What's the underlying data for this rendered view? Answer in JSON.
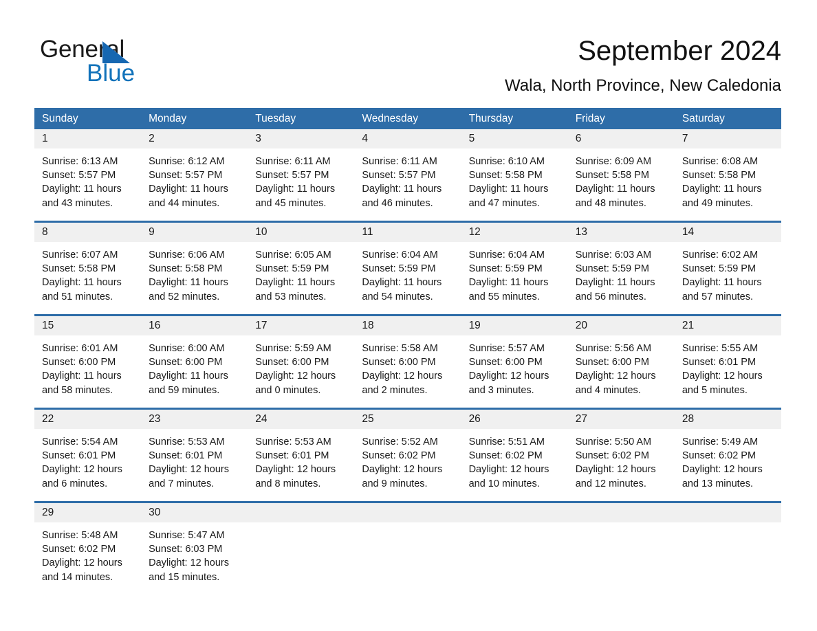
{
  "brand": {
    "name_part1": "General",
    "name_part2": "Blue",
    "accent_color": "#1172ba",
    "triangle_color": "#1667b1"
  },
  "header": {
    "title": "September 2024",
    "subtitle": "Wala, North Province, New Caledonia"
  },
  "theme": {
    "header_blue": "#2E6DA8",
    "day_band_gray": "#f0f0f0",
    "text_color": "#1a1a1a"
  },
  "weekdays": [
    "Sunday",
    "Monday",
    "Tuesday",
    "Wednesday",
    "Thursday",
    "Friday",
    "Saturday"
  ],
  "weeks": [
    [
      {
        "day": "1",
        "sunrise": "Sunrise: 6:13 AM",
        "sunset": "Sunset: 5:57 PM",
        "daylight1": "Daylight: 11 hours",
        "daylight2": "and 43 minutes."
      },
      {
        "day": "2",
        "sunrise": "Sunrise: 6:12 AM",
        "sunset": "Sunset: 5:57 PM",
        "daylight1": "Daylight: 11 hours",
        "daylight2": "and 44 minutes."
      },
      {
        "day": "3",
        "sunrise": "Sunrise: 6:11 AM",
        "sunset": "Sunset: 5:57 PM",
        "daylight1": "Daylight: 11 hours",
        "daylight2": "and 45 minutes."
      },
      {
        "day": "4",
        "sunrise": "Sunrise: 6:11 AM",
        "sunset": "Sunset: 5:57 PM",
        "daylight1": "Daylight: 11 hours",
        "daylight2": "and 46 minutes."
      },
      {
        "day": "5",
        "sunrise": "Sunrise: 6:10 AM",
        "sunset": "Sunset: 5:58 PM",
        "daylight1": "Daylight: 11 hours",
        "daylight2": "and 47 minutes."
      },
      {
        "day": "6",
        "sunrise": "Sunrise: 6:09 AM",
        "sunset": "Sunset: 5:58 PM",
        "daylight1": "Daylight: 11 hours",
        "daylight2": "and 48 minutes."
      },
      {
        "day": "7",
        "sunrise": "Sunrise: 6:08 AM",
        "sunset": "Sunset: 5:58 PM",
        "daylight1": "Daylight: 11 hours",
        "daylight2": "and 49 minutes."
      }
    ],
    [
      {
        "day": "8",
        "sunrise": "Sunrise: 6:07 AM",
        "sunset": "Sunset: 5:58 PM",
        "daylight1": "Daylight: 11 hours",
        "daylight2": "and 51 minutes."
      },
      {
        "day": "9",
        "sunrise": "Sunrise: 6:06 AM",
        "sunset": "Sunset: 5:58 PM",
        "daylight1": "Daylight: 11 hours",
        "daylight2": "and 52 minutes."
      },
      {
        "day": "10",
        "sunrise": "Sunrise: 6:05 AM",
        "sunset": "Sunset: 5:59 PM",
        "daylight1": "Daylight: 11 hours",
        "daylight2": "and 53 minutes."
      },
      {
        "day": "11",
        "sunrise": "Sunrise: 6:04 AM",
        "sunset": "Sunset: 5:59 PM",
        "daylight1": "Daylight: 11 hours",
        "daylight2": "and 54 minutes."
      },
      {
        "day": "12",
        "sunrise": "Sunrise: 6:04 AM",
        "sunset": "Sunset: 5:59 PM",
        "daylight1": "Daylight: 11 hours",
        "daylight2": "and 55 minutes."
      },
      {
        "day": "13",
        "sunrise": "Sunrise: 6:03 AM",
        "sunset": "Sunset: 5:59 PM",
        "daylight1": "Daylight: 11 hours",
        "daylight2": "and 56 minutes."
      },
      {
        "day": "14",
        "sunrise": "Sunrise: 6:02 AM",
        "sunset": "Sunset: 5:59 PM",
        "daylight1": "Daylight: 11 hours",
        "daylight2": "and 57 minutes."
      }
    ],
    [
      {
        "day": "15",
        "sunrise": "Sunrise: 6:01 AM",
        "sunset": "Sunset: 6:00 PM",
        "daylight1": "Daylight: 11 hours",
        "daylight2": "and 58 minutes."
      },
      {
        "day": "16",
        "sunrise": "Sunrise: 6:00 AM",
        "sunset": "Sunset: 6:00 PM",
        "daylight1": "Daylight: 11 hours",
        "daylight2": "and 59 minutes."
      },
      {
        "day": "17",
        "sunrise": "Sunrise: 5:59 AM",
        "sunset": "Sunset: 6:00 PM",
        "daylight1": "Daylight: 12 hours",
        "daylight2": "and 0 minutes."
      },
      {
        "day": "18",
        "sunrise": "Sunrise: 5:58 AM",
        "sunset": "Sunset: 6:00 PM",
        "daylight1": "Daylight: 12 hours",
        "daylight2": "and 2 minutes."
      },
      {
        "day": "19",
        "sunrise": "Sunrise: 5:57 AM",
        "sunset": "Sunset: 6:00 PM",
        "daylight1": "Daylight: 12 hours",
        "daylight2": "and 3 minutes."
      },
      {
        "day": "20",
        "sunrise": "Sunrise: 5:56 AM",
        "sunset": "Sunset: 6:00 PM",
        "daylight1": "Daylight: 12 hours",
        "daylight2": "and 4 minutes."
      },
      {
        "day": "21",
        "sunrise": "Sunrise: 5:55 AM",
        "sunset": "Sunset: 6:01 PM",
        "daylight1": "Daylight: 12 hours",
        "daylight2": "and 5 minutes."
      }
    ],
    [
      {
        "day": "22",
        "sunrise": "Sunrise: 5:54 AM",
        "sunset": "Sunset: 6:01 PM",
        "daylight1": "Daylight: 12 hours",
        "daylight2": "and 6 minutes."
      },
      {
        "day": "23",
        "sunrise": "Sunrise: 5:53 AM",
        "sunset": "Sunset: 6:01 PM",
        "daylight1": "Daylight: 12 hours",
        "daylight2": "and 7 minutes."
      },
      {
        "day": "24",
        "sunrise": "Sunrise: 5:53 AM",
        "sunset": "Sunset: 6:01 PM",
        "daylight1": "Daylight: 12 hours",
        "daylight2": "and 8 minutes."
      },
      {
        "day": "25",
        "sunrise": "Sunrise: 5:52 AM",
        "sunset": "Sunset: 6:02 PM",
        "daylight1": "Daylight: 12 hours",
        "daylight2": "and 9 minutes."
      },
      {
        "day": "26",
        "sunrise": "Sunrise: 5:51 AM",
        "sunset": "Sunset: 6:02 PM",
        "daylight1": "Daylight: 12 hours",
        "daylight2": "and 10 minutes."
      },
      {
        "day": "27",
        "sunrise": "Sunrise: 5:50 AM",
        "sunset": "Sunset: 6:02 PM",
        "daylight1": "Daylight: 12 hours",
        "daylight2": "and 12 minutes."
      },
      {
        "day": "28",
        "sunrise": "Sunrise: 5:49 AM",
        "sunset": "Sunset: 6:02 PM",
        "daylight1": "Daylight: 12 hours",
        "daylight2": "and 13 minutes."
      }
    ],
    [
      {
        "day": "29",
        "sunrise": "Sunrise: 5:48 AM",
        "sunset": "Sunset: 6:02 PM",
        "daylight1": "Daylight: 12 hours",
        "daylight2": "and 14 minutes."
      },
      {
        "day": "30",
        "sunrise": "Sunrise: 5:47 AM",
        "sunset": "Sunset: 6:03 PM",
        "daylight1": "Daylight: 12 hours",
        "daylight2": "and 15 minutes."
      },
      {
        "day": "",
        "sunrise": "",
        "sunset": "",
        "daylight1": "",
        "daylight2": ""
      },
      {
        "day": "",
        "sunrise": "",
        "sunset": "",
        "daylight1": "",
        "daylight2": ""
      },
      {
        "day": "",
        "sunrise": "",
        "sunset": "",
        "daylight1": "",
        "daylight2": ""
      },
      {
        "day": "",
        "sunrise": "",
        "sunset": "",
        "daylight1": "",
        "daylight2": ""
      },
      {
        "day": "",
        "sunrise": "",
        "sunset": "",
        "daylight1": "",
        "daylight2": ""
      }
    ]
  ]
}
